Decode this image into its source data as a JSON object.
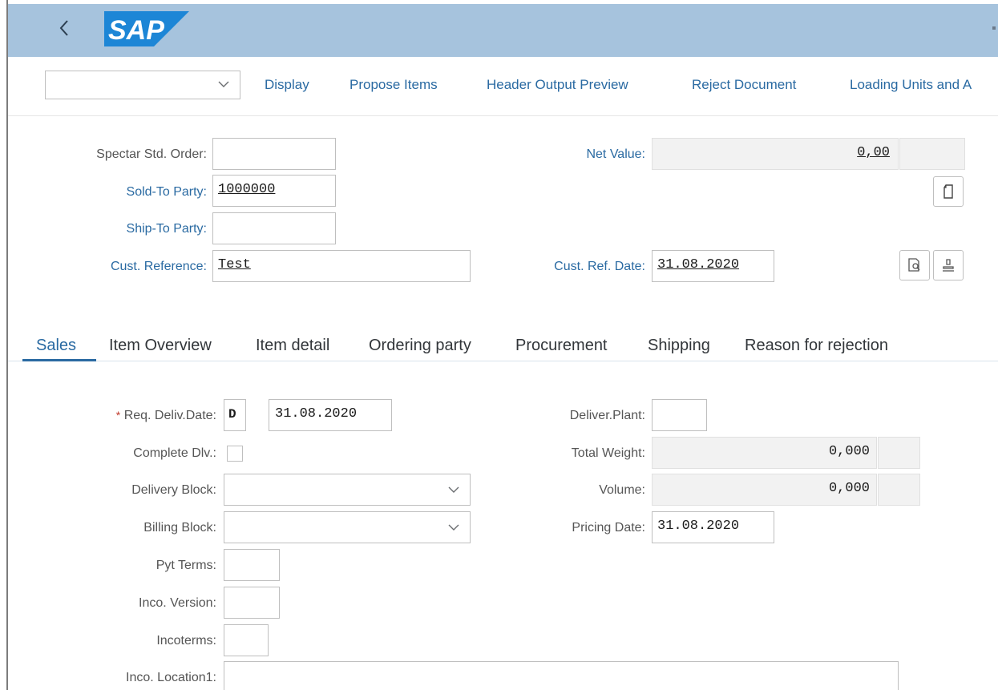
{
  "shell": {
    "logo_text": "SAP",
    "icons": {
      "back": "chevron-left-icon"
    }
  },
  "toolbar": {
    "actions": [
      "Display",
      "Propose Items",
      "Header Output Preview",
      "Reject Document",
      "Loading Units and A"
    ],
    "select_value": ""
  },
  "header": {
    "order_label": "Spectar Std. Order:",
    "order_value": "",
    "sold_to_label": "Sold-To Party:",
    "sold_to_value": "1000000",
    "ship_to_label": "Ship-To Party:",
    "ship_to_value": "",
    "cust_ref_label": "Cust. Reference:",
    "cust_ref_value": "Test",
    "net_value_label": "Net Value:",
    "net_value": "0,00",
    "net_currency": "",
    "cust_ref_date_label": "Cust. Ref. Date:",
    "cust_ref_date_value": "31.08.2020",
    "icons": {
      "copy": "document-icon",
      "display_doc": "document-search-icon",
      "stamp": "stamp-icon"
    }
  },
  "tabs": {
    "active": "Sales",
    "items": [
      "Sales",
      "Item Overview",
      "Item detail",
      "Ordering party",
      "Procurement",
      "Shipping",
      "Reason for rejection"
    ]
  },
  "sales": {
    "req_deliv_label": "Req. Deliv.Date:",
    "req_star": "*",
    "req_deliv_type": "D",
    "req_deliv_value": "31.08.2020",
    "complete_dlv_label": "Complete Dlv.:",
    "complete_dlv_checked": false,
    "delivery_block_label": "Delivery Block:",
    "delivery_block_value": "",
    "billing_block_label": "Billing Block:",
    "billing_block_value": "",
    "pyt_terms_label": "Pyt Terms:",
    "pyt_terms_value": "",
    "inco_version_label": "Inco. Version:",
    "inco_version_value": "",
    "incoterms_label": "Incoterms:",
    "incoterms_value": "",
    "inco_location_label": "Inco. Location1:",
    "inco_location_value": "",
    "deliver_plant_label": "Deliver.Plant:",
    "deliver_plant_value": "",
    "total_weight_label": "Total Weight:",
    "total_weight_value": "0,000",
    "total_weight_unit": "",
    "volume_label": "Volume:",
    "volume_value": "0,000",
    "volume_unit": "",
    "pricing_date_label": "Pricing Date:",
    "pricing_date_value": "31.08.2020"
  }
}
